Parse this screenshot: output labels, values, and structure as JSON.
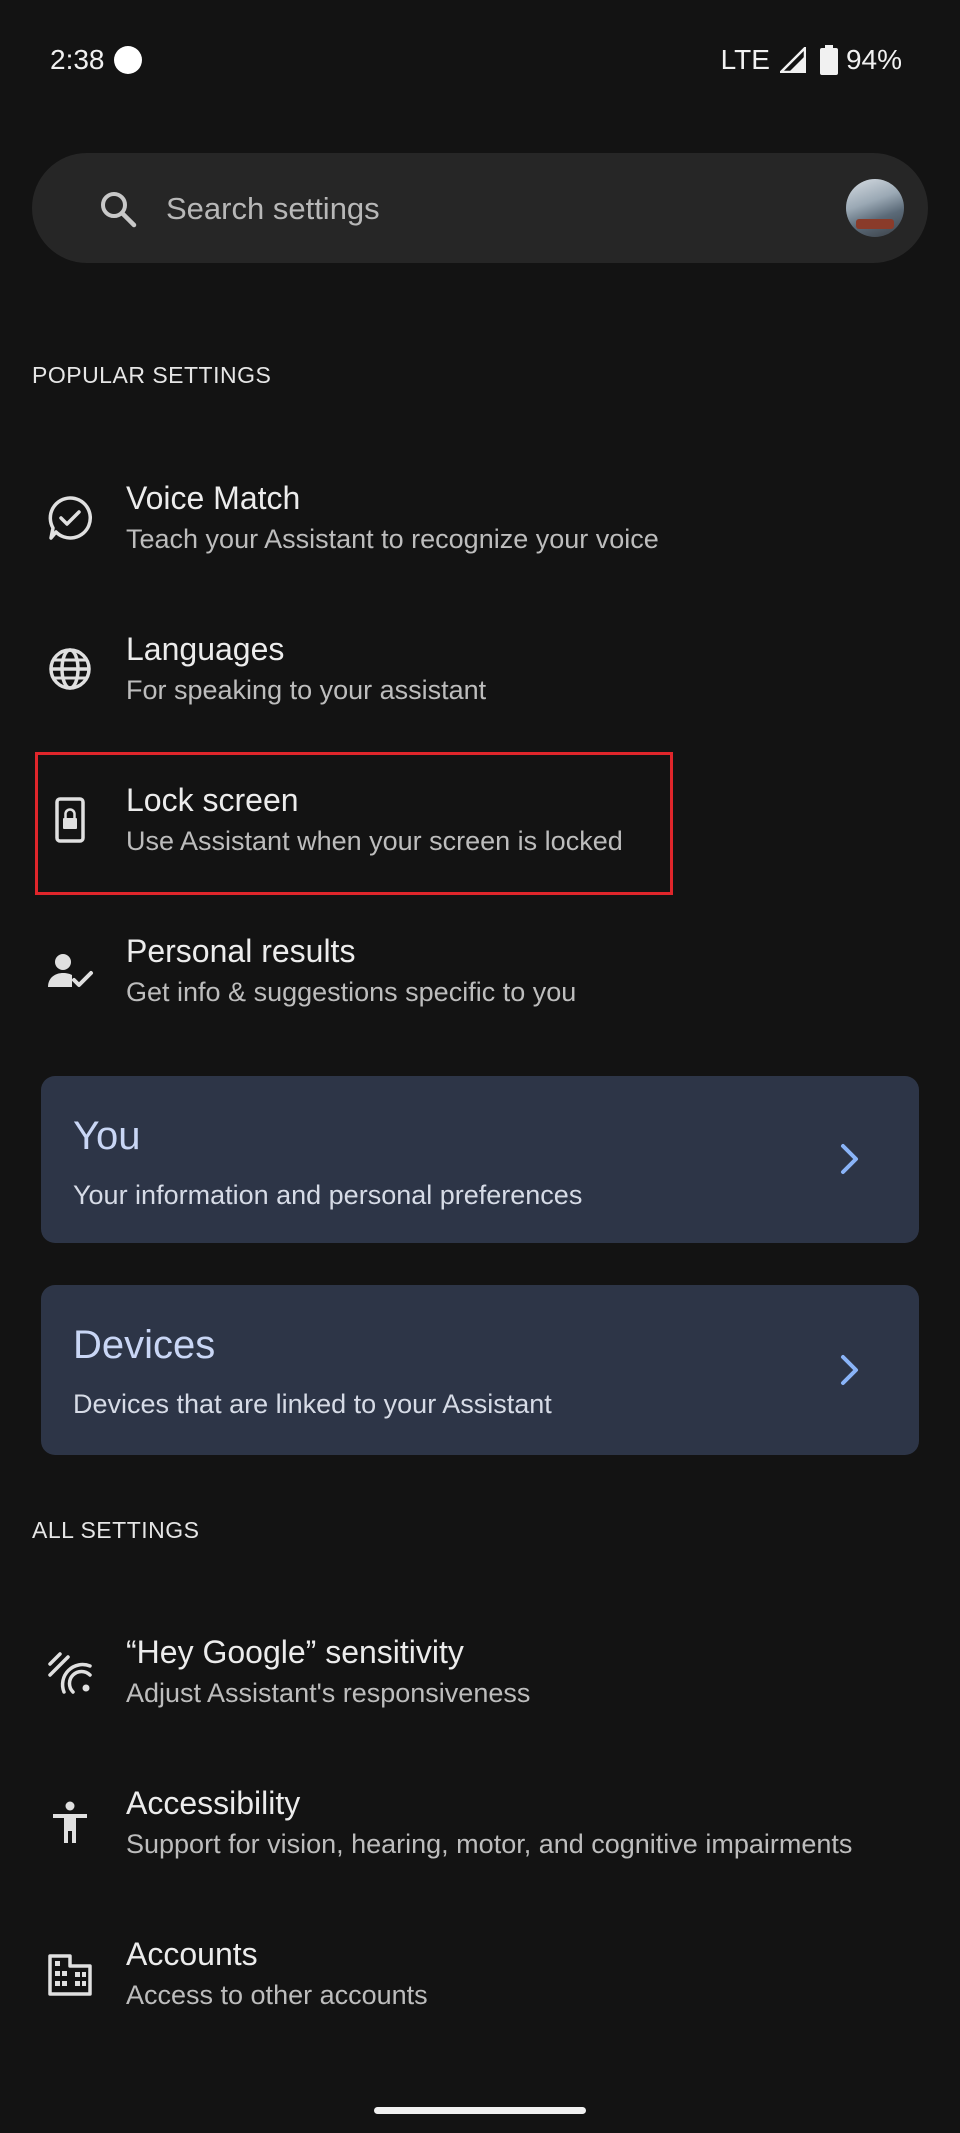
{
  "status_bar": {
    "time": "2:38",
    "network": "LTE",
    "battery": "94%"
  },
  "search": {
    "placeholder": "Search settings"
  },
  "popular": {
    "header": "POPULAR SETTINGS",
    "items": [
      {
        "title": "Voice Match",
        "subtitle": "Teach your Assistant to recognize your voice",
        "icon": "voice-match-icon"
      },
      {
        "title": "Languages",
        "subtitle": "For speaking to your assistant",
        "icon": "globe-icon"
      },
      {
        "title": "Lock screen",
        "subtitle": "Use Assistant when your screen is locked",
        "icon": "lock-screen-icon"
      },
      {
        "title": "Personal results",
        "subtitle": "Get info & suggestions specific to you",
        "icon": "person-check-icon"
      }
    ]
  },
  "cards": [
    {
      "title": "You",
      "subtitle": "Your information and personal preferences"
    },
    {
      "title": "Devices",
      "subtitle": "Devices that are linked to your Assistant"
    }
  ],
  "all": {
    "header": "ALL SETTINGS",
    "items": [
      {
        "title": "“Hey Google” sensitivity",
        "subtitle": "Adjust Assistant's responsiveness",
        "icon": "sensitivity-icon"
      },
      {
        "title": "Accessibility",
        "subtitle": "Support for vision, hearing, motor, and cognitive impairments",
        "icon": "accessibility-icon"
      },
      {
        "title": "Accounts",
        "subtitle": "Access to other accounts",
        "icon": "building-icon"
      }
    ]
  },
  "colors": {
    "background": "#131313",
    "card": "#2d3547",
    "accent": "#8ab4f8",
    "highlight": "#e0262b"
  }
}
